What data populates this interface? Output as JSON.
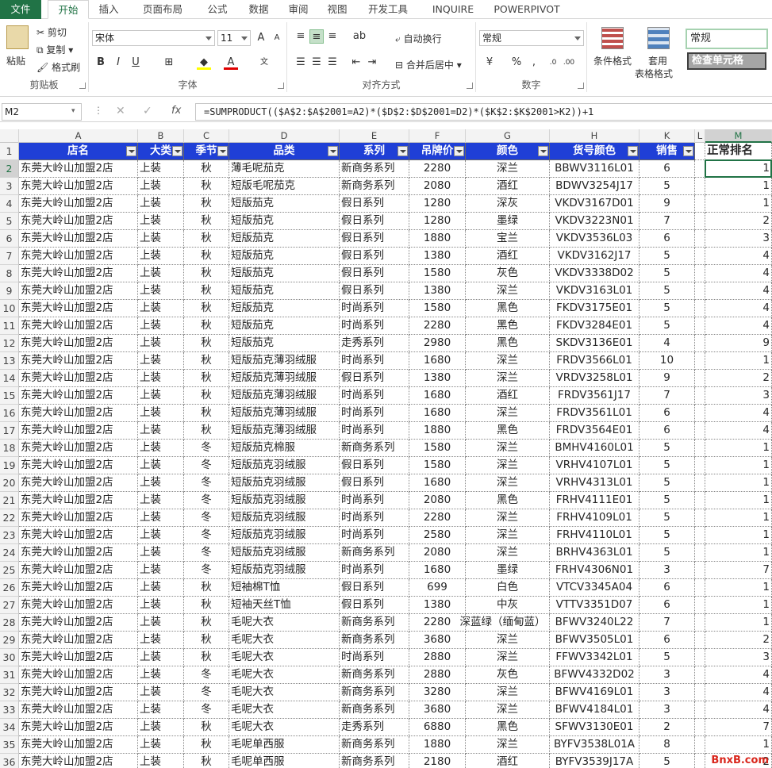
{
  "tabs": [
    "文件",
    "开始",
    "插入",
    "页面布局",
    "公式",
    "数据",
    "审阅",
    "视图",
    "开发工具",
    "INQUIRE",
    "POWERPIVOT"
  ],
  "ribbon": {
    "clipboard": {
      "paste": "粘贴",
      "cut": "剪切",
      "copy": "复制",
      "painter": "格式刷",
      "label": "剪贴板"
    },
    "font": {
      "name": "宋体",
      "size": "11",
      "label": "字体",
      "bold": "B",
      "italic": "I",
      "underline": "U"
    },
    "align": {
      "wrap": "自动换行",
      "merge": "合并后居中",
      "label": "对齐方式"
    },
    "number": {
      "format": "常规",
      "label": "数字",
      "percent": "%",
      "comma": ","
    },
    "styles": {
      "cond": "条件格式",
      "table1": "套用",
      "table2": "表格格式",
      "style_normal": "常规",
      "style_check": "检查单元格"
    }
  },
  "formula_bar": {
    "name_box": "M2",
    "formula": "=SUMPRODUCT(($A$2:$A$2001=A2)*($D$2:$D$2001=D2)*($K$2:$K$2001>K2))+1"
  },
  "columns": [
    "A",
    "B",
    "C",
    "D",
    "E",
    "F",
    "G",
    "H",
    "K",
    "L",
    "M"
  ],
  "headers": [
    "店名",
    "大类",
    "季节",
    "品类",
    "系列",
    "吊牌价",
    "颜色",
    "货号颜色",
    "销售",
    "",
    "正常排名"
  ],
  "rows": [
    [
      "2",
      "东莞大岭山加盟2店",
      "上装",
      "秋",
      "薄毛呢茄克",
      "新商务系列",
      "2280",
      "深兰",
      "BBWV3116L01",
      "6",
      "1"
    ],
    [
      "3",
      "东莞大岭山加盟2店",
      "上装",
      "秋",
      "短版毛呢茄克",
      "新商务系列",
      "2080",
      "酒红",
      "BDWV3254J17",
      "5",
      "1"
    ],
    [
      "4",
      "东莞大岭山加盟2店",
      "上装",
      "秋",
      "短版茄克",
      "假日系列",
      "1280",
      "深灰",
      "VKDV3167D01",
      "9",
      "1"
    ],
    [
      "5",
      "东莞大岭山加盟2店",
      "上装",
      "秋",
      "短版茄克",
      "假日系列",
      "1280",
      "墨绿",
      "VKDV3223N01",
      "7",
      "2"
    ],
    [
      "6",
      "东莞大岭山加盟2店",
      "上装",
      "秋",
      "短版茄克",
      "假日系列",
      "1880",
      "宝兰",
      "VKDV3536L03",
      "6",
      "3"
    ],
    [
      "7",
      "东莞大岭山加盟2店",
      "上装",
      "秋",
      "短版茄克",
      "假日系列",
      "1380",
      "酒红",
      "VKDV3162J17",
      "5",
      "4"
    ],
    [
      "8",
      "东莞大岭山加盟2店",
      "上装",
      "秋",
      "短版茄克",
      "假日系列",
      "1580",
      "灰色",
      "VKDV3338D02",
      "5",
      "4"
    ],
    [
      "9",
      "东莞大岭山加盟2店",
      "上装",
      "秋",
      "短版茄克",
      "假日系列",
      "1380",
      "深兰",
      "VKDV3163L01",
      "5",
      "4"
    ],
    [
      "10",
      "东莞大岭山加盟2店",
      "上装",
      "秋",
      "短版茄克",
      "时尚系列",
      "1580",
      "黑色",
      "FKDV3175E01",
      "5",
      "4"
    ],
    [
      "11",
      "东莞大岭山加盟2店",
      "上装",
      "秋",
      "短版茄克",
      "时尚系列",
      "2280",
      "黑色",
      "FKDV3284E01",
      "5",
      "4"
    ],
    [
      "12",
      "东莞大岭山加盟2店",
      "上装",
      "秋",
      "短版茄克",
      "走秀系列",
      "2980",
      "黑色",
      "SKDV3136E01",
      "4",
      "9"
    ],
    [
      "13",
      "东莞大岭山加盟2店",
      "上装",
      "秋",
      "短版茄克薄羽绒服",
      "时尚系列",
      "1680",
      "深兰",
      "FRDV3566L01",
      "10",
      "1"
    ],
    [
      "14",
      "东莞大岭山加盟2店",
      "上装",
      "秋",
      "短版茄克薄羽绒服",
      "假日系列",
      "1380",
      "深兰",
      "VRDV3258L01",
      "9",
      "2"
    ],
    [
      "15",
      "东莞大岭山加盟2店",
      "上装",
      "秋",
      "短版茄克薄羽绒服",
      "时尚系列",
      "1680",
      "酒红",
      "FRDV3561J17",
      "7",
      "3"
    ],
    [
      "16",
      "东莞大岭山加盟2店",
      "上装",
      "秋",
      "短版茄克薄羽绒服",
      "时尚系列",
      "1680",
      "深兰",
      "FRDV3561L01",
      "6",
      "4"
    ],
    [
      "17",
      "东莞大岭山加盟2店",
      "上装",
      "秋",
      "短版茄克薄羽绒服",
      "时尚系列",
      "1880",
      "黑色",
      "FRDV3564E01",
      "6",
      "4"
    ],
    [
      "18",
      "东莞大岭山加盟2店",
      "上装",
      "冬",
      "短版茄克棉服",
      "新商务系列",
      "1580",
      "深兰",
      "BMHV4160L01",
      "5",
      "1"
    ],
    [
      "19",
      "东莞大岭山加盟2店",
      "上装",
      "冬",
      "短版茄克羽绒服",
      "假日系列",
      "1580",
      "深兰",
      "VRHV4107L01",
      "5",
      "1"
    ],
    [
      "20",
      "东莞大岭山加盟2店",
      "上装",
      "冬",
      "短版茄克羽绒服",
      "假日系列",
      "1680",
      "深兰",
      "VRHV4313L01",
      "5",
      "1"
    ],
    [
      "21",
      "东莞大岭山加盟2店",
      "上装",
      "冬",
      "短版茄克羽绒服",
      "时尚系列",
      "2080",
      "黑色",
      "FRHV4111E01",
      "5",
      "1"
    ],
    [
      "22",
      "东莞大岭山加盟2店",
      "上装",
      "冬",
      "短版茄克羽绒服",
      "时尚系列",
      "2280",
      "深兰",
      "FRHV4109L01",
      "5",
      "1"
    ],
    [
      "23",
      "东莞大岭山加盟2店",
      "上装",
      "冬",
      "短版茄克羽绒服",
      "时尚系列",
      "2580",
      "深兰",
      "FRHV4110L01",
      "5",
      "1"
    ],
    [
      "24",
      "东莞大岭山加盟2店",
      "上装",
      "冬",
      "短版茄克羽绒服",
      "新商务系列",
      "2080",
      "深兰",
      "BRHV4363L01",
      "5",
      "1"
    ],
    [
      "25",
      "东莞大岭山加盟2店",
      "上装",
      "冬",
      "短版茄克羽绒服",
      "时尚系列",
      "1680",
      "墨绿",
      "FRHV4306N01",
      "3",
      "7"
    ],
    [
      "26",
      "东莞大岭山加盟2店",
      "上装",
      "秋",
      "短袖棉T恤",
      "假日系列",
      "699",
      "白色",
      "VTCV3345A04",
      "6",
      "1"
    ],
    [
      "27",
      "东莞大岭山加盟2店",
      "上装",
      "秋",
      "短袖天丝T恤",
      "假日系列",
      "1380",
      "中灰",
      "VTTV3351D07",
      "6",
      "1"
    ],
    [
      "28",
      "东莞大岭山加盟2店",
      "上装",
      "秋",
      "毛呢大衣",
      "新商务系列",
      "2280",
      "深蓝绿（缅甸蓝）",
      "BFWV3240L22",
      "7",
      "1"
    ],
    [
      "29",
      "东莞大岭山加盟2店",
      "上装",
      "秋",
      "毛呢大衣",
      "新商务系列",
      "3680",
      "深兰",
      "BFWV3505L01",
      "6",
      "2"
    ],
    [
      "30",
      "东莞大岭山加盟2店",
      "上装",
      "秋",
      "毛呢大衣",
      "时尚系列",
      "2880",
      "深兰",
      "FFWV3342L01",
      "5",
      "3"
    ],
    [
      "31",
      "东莞大岭山加盟2店",
      "上装",
      "冬",
      "毛呢大衣",
      "新商务系列",
      "2880",
      "灰色",
      "BFWV4332D02",
      "3",
      "4"
    ],
    [
      "32",
      "东莞大岭山加盟2店",
      "上装",
      "冬",
      "毛呢大衣",
      "新商务系列",
      "3280",
      "深兰",
      "BFWV4169L01",
      "3",
      "4"
    ],
    [
      "33",
      "东莞大岭山加盟2店",
      "上装",
      "冬",
      "毛呢大衣",
      "新商务系列",
      "3680",
      "深兰",
      "BFWV4184L01",
      "3",
      "4"
    ],
    [
      "34",
      "东莞大岭山加盟2店",
      "上装",
      "秋",
      "毛呢大衣",
      "走秀系列",
      "6880",
      "黑色",
      "SFWV3130E01",
      "2",
      "7"
    ],
    [
      "35",
      "东莞大岭山加盟2店",
      "上装",
      "秋",
      "毛呢单西服",
      "新商务系列",
      "1880",
      "深兰",
      "BYFV3538L01A",
      "8",
      "1"
    ],
    [
      "36",
      "东莞大岭山加盟2店",
      "上装",
      "秋",
      "毛呢单西服",
      "新商务系列",
      "2180",
      "酒红",
      "BYFV3539J17A",
      "5",
      "2"
    ]
  ],
  "watermark": "BnxB.com"
}
